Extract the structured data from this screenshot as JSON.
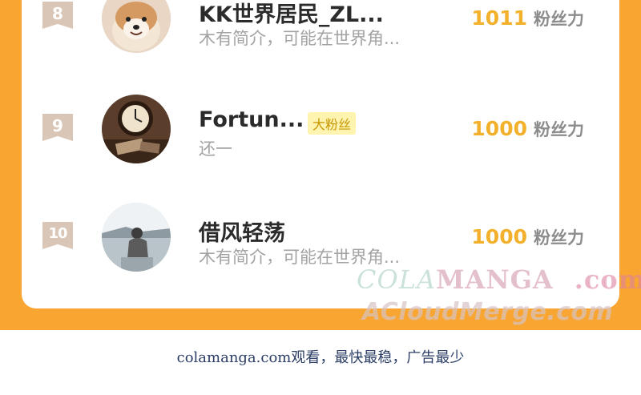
{
  "entries": [
    {
      "rank": "8",
      "name": "KK世界居民_ZL...",
      "bio": "木有简介，可能在世界角...",
      "fans_count": "1011",
      "fans_unit": "粉丝力"
    },
    {
      "rank": "9",
      "name": "Fortun...",
      "badge": "大粉丝",
      "bio": "还一",
      "fans_count": "1000",
      "fans_unit": "粉丝力"
    },
    {
      "rank": "10",
      "name": "借风轻荡",
      "bio": "木有简介，可能在世界角...",
      "fans_count": "1000",
      "fans_unit": "粉丝力"
    }
  ],
  "watermark": {
    "line1_a": "COLA",
    "line1_b": "MANGA",
    "line1_c": ".com",
    "line2": "ACloudMerge.com"
  },
  "footer": "colamanga.com观看，最快最稳，广告最少",
  "colors": {
    "frame": "#f9a531",
    "fans_number": "#f3b12b",
    "rank_badge": "#d9c6b6",
    "fan_badge_bg": "#fff3b0"
  }
}
